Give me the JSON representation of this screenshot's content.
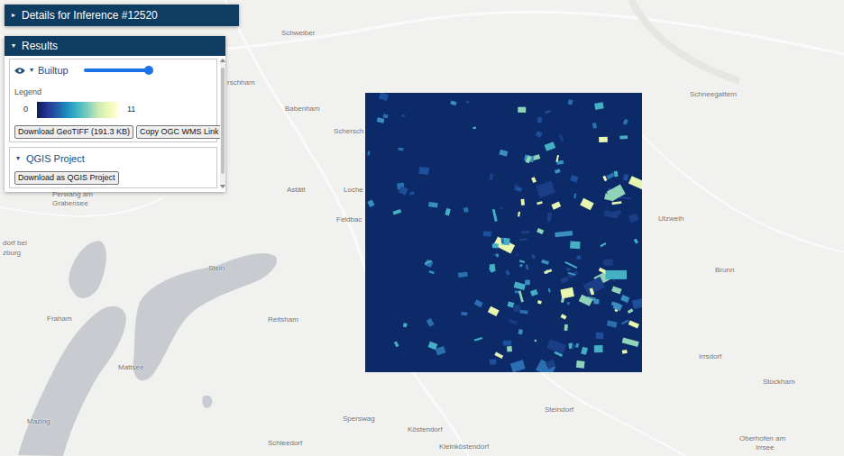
{
  "details_panel": {
    "toggle": "▸",
    "title": "Details for Inference #12520",
    "expanded": false
  },
  "results_panel": {
    "toggle": "▾",
    "title": "Results",
    "expanded": true,
    "layers": [
      {
        "name": "Builtup",
        "toggle": "▾",
        "visible": true,
        "expanded": true,
        "opacity": 0.95,
        "legend": {
          "title": "Legend",
          "min": "0",
          "max": "11"
        },
        "buttons": [
          "Download GeoTIFF (191.3 KB)",
          "Copy OGC WMS Link"
        ]
      }
    ],
    "qgis": {
      "toggle": "▾",
      "title": "QGIS Project",
      "expanded": true,
      "button": "Download as QGIS Project"
    }
  },
  "map": {
    "labels": [
      "Schweiber",
      "rschham",
      "Babenham",
      "Schersch",
      "Astätt",
      "Loche",
      "Feldbac",
      "Perwang am",
      "Grabensee",
      "dorf bei",
      "zburg",
      "Stein",
      "Reitsham",
      "Fraham",
      "Mattsee",
      "Mazing",
      "Schleedorf",
      "Sperswag",
      "Köstendorf",
      "Kleinköstendorf",
      "Steindorf",
      "Irrsdorf",
      "Stockham",
      "Oberhofen am",
      "Irrsee",
      "Utzweih",
      "Brunn",
      "Schneegattern"
    ]
  }
}
